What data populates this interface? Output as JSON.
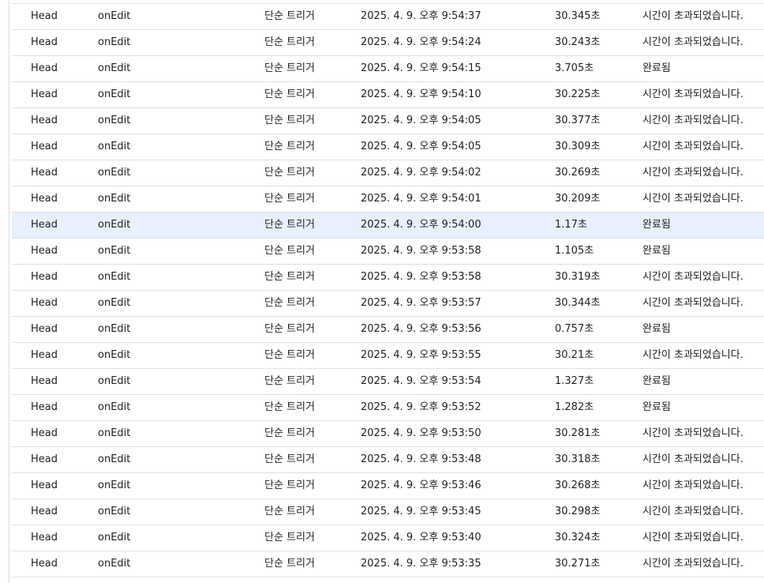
{
  "executions": [
    {
      "deployment": "Head",
      "function": "onEdit",
      "type": "단순 트리거",
      "start": "2025. 4. 9. 오후 9:54:37",
      "duration": "30.345초",
      "status": "시간이 초과되었습니다."
    },
    {
      "deployment": "Head",
      "function": "onEdit",
      "type": "단순 트리거",
      "start": "2025. 4. 9. 오후 9:54:24",
      "duration": "30.243초",
      "status": "시간이 초과되었습니다."
    },
    {
      "deployment": "Head",
      "function": "onEdit",
      "type": "단순 트리거",
      "start": "2025. 4. 9. 오후 9:54:15",
      "duration": "3.705초",
      "status": "완료됨"
    },
    {
      "deployment": "Head",
      "function": "onEdit",
      "type": "단순 트리거",
      "start": "2025. 4. 9. 오후 9:54:10",
      "duration": "30.225초",
      "status": "시간이 초과되었습니다."
    },
    {
      "deployment": "Head",
      "function": "onEdit",
      "type": "단순 트리거",
      "start": "2025. 4. 9. 오후 9:54:05",
      "duration": "30.377초",
      "status": "시간이 초과되었습니다."
    },
    {
      "deployment": "Head",
      "function": "onEdit",
      "type": "단순 트리거",
      "start": "2025. 4. 9. 오후 9:54:05",
      "duration": "30.309초",
      "status": "시간이 초과되었습니다."
    },
    {
      "deployment": "Head",
      "function": "onEdit",
      "type": "단순 트리거",
      "start": "2025. 4. 9. 오후 9:54:02",
      "duration": "30.269초",
      "status": "시간이 초과되었습니다."
    },
    {
      "deployment": "Head",
      "function": "onEdit",
      "type": "단순 트리거",
      "start": "2025. 4. 9. 오후 9:54:01",
      "duration": "30.209초",
      "status": "시간이 초과되었습니다."
    },
    {
      "deployment": "Head",
      "function": "onEdit",
      "type": "단순 트리거",
      "start": "2025. 4. 9. 오후 9:54:00",
      "duration": "1.17초",
      "status": "완료됨",
      "selected": true
    },
    {
      "deployment": "Head",
      "function": "onEdit",
      "type": "단순 트리거",
      "start": "2025. 4. 9. 오후 9:53:58",
      "duration": "1.105초",
      "status": "완료됨"
    },
    {
      "deployment": "Head",
      "function": "onEdit",
      "type": "단순 트리거",
      "start": "2025. 4. 9. 오후 9:53:58",
      "duration": "30.319초",
      "status": "시간이 초과되었습니다."
    },
    {
      "deployment": "Head",
      "function": "onEdit",
      "type": "단순 트리거",
      "start": "2025. 4. 9. 오후 9:53:57",
      "duration": "30.344초",
      "status": "시간이 초과되었습니다."
    },
    {
      "deployment": "Head",
      "function": "onEdit",
      "type": "단순 트리거",
      "start": "2025. 4. 9. 오후 9:53:56",
      "duration": "0.757초",
      "status": "완료됨"
    },
    {
      "deployment": "Head",
      "function": "onEdit",
      "type": "단순 트리거",
      "start": "2025. 4. 9. 오후 9:53:55",
      "duration": "30.21초",
      "status": "시간이 초과되었습니다."
    },
    {
      "deployment": "Head",
      "function": "onEdit",
      "type": "단순 트리거",
      "start": "2025. 4. 9. 오후 9:53:54",
      "duration": "1.327초",
      "status": "완료됨"
    },
    {
      "deployment": "Head",
      "function": "onEdit",
      "type": "단순 트리거",
      "start": "2025. 4. 9. 오후 9:53:52",
      "duration": "1.282초",
      "status": "완료됨"
    },
    {
      "deployment": "Head",
      "function": "onEdit",
      "type": "단순 트리거",
      "start": "2025. 4. 9. 오후 9:53:50",
      "duration": "30.281초",
      "status": "시간이 초과되었습니다."
    },
    {
      "deployment": "Head",
      "function": "onEdit",
      "type": "단순 트리거",
      "start": "2025. 4. 9. 오후 9:53:48",
      "duration": "30.318초",
      "status": "시간이 초과되었습니다."
    },
    {
      "deployment": "Head",
      "function": "onEdit",
      "type": "단순 트리거",
      "start": "2025. 4. 9. 오후 9:53:46",
      "duration": "30.268초",
      "status": "시간이 초과되었습니다."
    },
    {
      "deployment": "Head",
      "function": "onEdit",
      "type": "단순 트리거",
      "start": "2025. 4. 9. 오후 9:53:45",
      "duration": "30.298초",
      "status": "시간이 초과되었습니다."
    },
    {
      "deployment": "Head",
      "function": "onEdit",
      "type": "단순 트리거",
      "start": "2025. 4. 9. 오후 9:53:40",
      "duration": "30.324초",
      "status": "시간이 초과되었습니다."
    },
    {
      "deployment": "Head",
      "function": "onEdit",
      "type": "단순 트리거",
      "start": "2025. 4. 9. 오후 9:53:35",
      "duration": "30.271초",
      "status": "시간이 초과되었습니다."
    }
  ]
}
